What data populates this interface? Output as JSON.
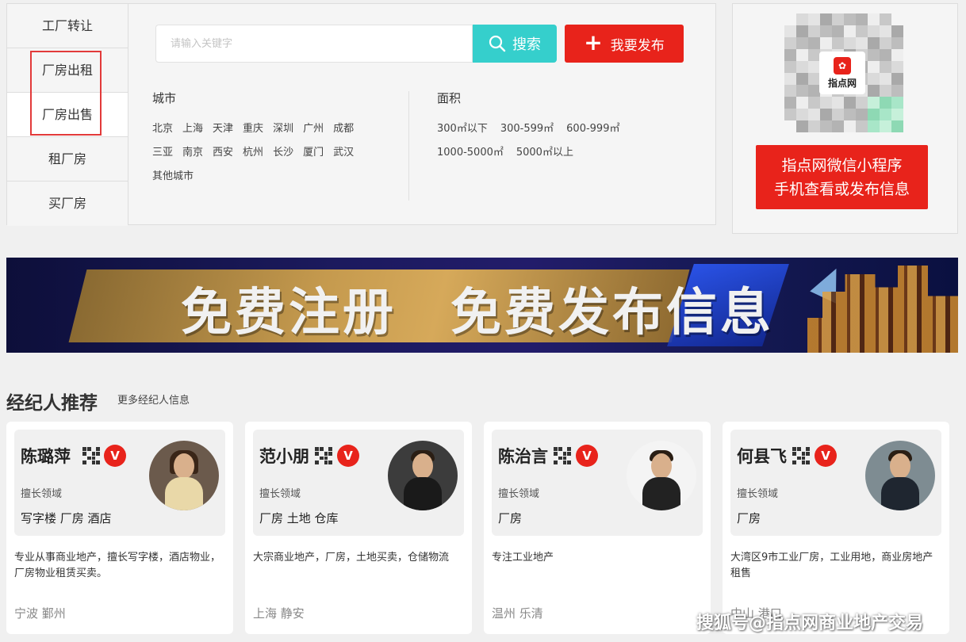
{
  "side_nav": {
    "items": [
      {
        "label": "工厂转让"
      },
      {
        "label": "厂房出租"
      },
      {
        "label": "厂房出售"
      },
      {
        "label": "租厂房"
      },
      {
        "label": "买厂房"
      }
    ],
    "active_index": 2
  },
  "search": {
    "placeholder": "请输入关键字",
    "value": "",
    "button_label": "搜索",
    "publish_label": "我要发布"
  },
  "filters": {
    "city_title": "城市",
    "cities": [
      [
        "北京",
        "上海",
        "天津",
        "重庆",
        "深圳",
        "广州",
        "成都"
      ],
      [
        "三亚",
        "南京",
        "西安",
        "杭州",
        "长沙",
        "厦门",
        "武汉"
      ],
      [
        "其他城市"
      ]
    ],
    "area_title": "面积",
    "areas": [
      [
        "300㎡以下",
        "300-599㎡",
        "600-999㎡"
      ],
      [
        "1000-5000㎡",
        "5000㎡以上"
      ]
    ]
  },
  "qr_panel": {
    "logo_name": "指点网",
    "line1": "指点网微信小程序",
    "line2": "手机查看或发布信息"
  },
  "banner": {
    "text": "免费注册　免费发布信息"
  },
  "agents_section": {
    "title": "经纪人推荐",
    "more_label": "更多经纪人信息",
    "agents": [
      {
        "name": "陈璐萍",
        "specialty_label": "擅长领域",
        "tags": "写字楼 厂房 酒店",
        "desc": "专业从事商业地产，擅长写字楼，酒店物业，厂房物业租赁买卖。",
        "location": "宁波 鄞州"
      },
      {
        "name": "范小朋",
        "specialty_label": "擅长领域",
        "tags": "厂房 土地 仓库",
        "desc": "大宗商业地产，厂房，土地买卖，仓储物流",
        "location": "上海 静安"
      },
      {
        "name": "陈治言",
        "specialty_label": "擅长领域",
        "tags": "厂房",
        "desc": "专注工业地产",
        "location": "温州 乐清"
      },
      {
        "name": "何县飞",
        "specialty_label": "擅长领域",
        "tags": "厂房",
        "desc": "大湾区9市工业厂房，工业用地，商业房地产租售",
        "location": "中山 港口"
      }
    ]
  },
  "watermark": "搜狐号@指点网商业地产交易",
  "colors": {
    "search_button": "#35cfcc",
    "publish_button": "#e8231b",
    "highlight_frame": "#e23a3a",
    "verified_badge": "#e8231b"
  }
}
